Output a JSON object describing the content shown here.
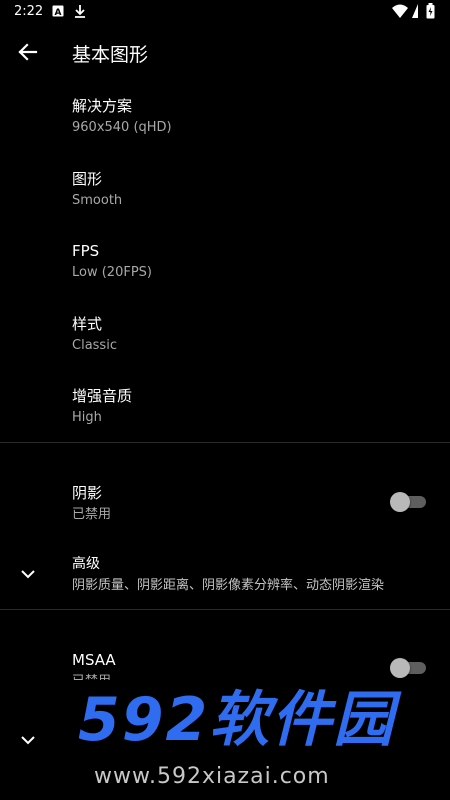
{
  "status_bar": {
    "time": "2:22",
    "icons": [
      "a-notification-icon",
      "download-icon",
      "wifi-icon",
      "battery-charging-icon"
    ]
  },
  "app_bar": {
    "title": "基本图形"
  },
  "preferences": [
    {
      "title": "解决方案",
      "summary": "960x540 (qHD)"
    },
    {
      "title": "图形",
      "summary": "Smooth"
    },
    {
      "title": "FPS",
      "summary": "Low (20FPS)"
    },
    {
      "title": "样式",
      "summary": "Classic"
    },
    {
      "title": "增强音质",
      "summary": "High"
    }
  ],
  "shadow": {
    "title": "阴影",
    "summary": "已禁用",
    "enabled": false
  },
  "advanced": {
    "title": "高级",
    "summary": "阴影质量、阴影距离、阴影像素分辨率、动态阴影渲染"
  },
  "msaa": {
    "title": "MSAA",
    "summary": "已禁用",
    "enabled": false
  },
  "watermark": {
    "logo": "592软件园",
    "url": "www.592xiazai.com"
  },
  "colors": {
    "background": "#000000",
    "summary_text": "#a8a8a8",
    "watermark_blue": "#2f6cf0"
  }
}
